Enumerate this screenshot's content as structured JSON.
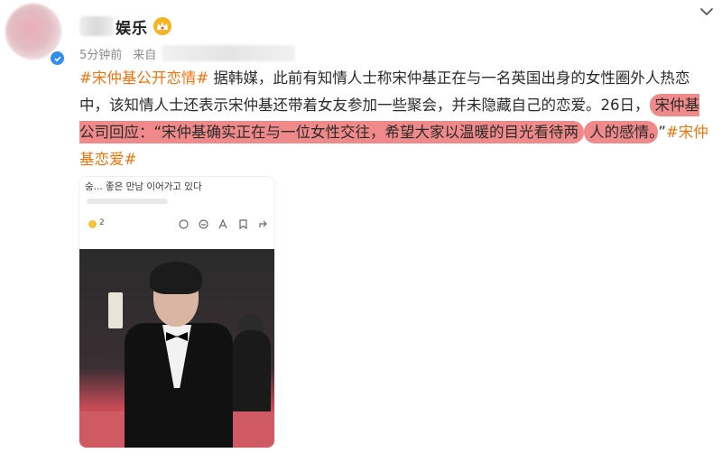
{
  "account": {
    "name_suffix": "娱乐",
    "time": "5分钟前",
    "from_label": "来自"
  },
  "post": {
    "tag1": "#宋仲基公开恋情#",
    "seg1": "据韩媒，此前有知情人士称宋仲基正在与一名英国出身的女性圈外人热恋中，该知情人士还表示宋仲基还带着女友参加一些聚会，并未隐藏自己的恋爱。26日，",
    "highlight1": "宋仲基公司回应：“宋仲基确实正在与一位女性交往，希望大家以温暖的目光看待两",
    "highlight2": "人的感情。",
    "seg2": "”",
    "tag2": "#宋仲基恋爱#"
  },
  "card": {
    "korean_text": "숭... 좋은 만남 이어가고 있다",
    "emoji_count": "2"
  },
  "icons": {
    "avatar": "avatar",
    "verified": "verified-badge-icon",
    "crown": "crown-icon",
    "menu": "chevron-down-icon"
  },
  "colors": {
    "tag": "#f2740d",
    "highlight": "#f08a8a",
    "verified": "#2f8ef0",
    "crown": "#f7b321"
  }
}
